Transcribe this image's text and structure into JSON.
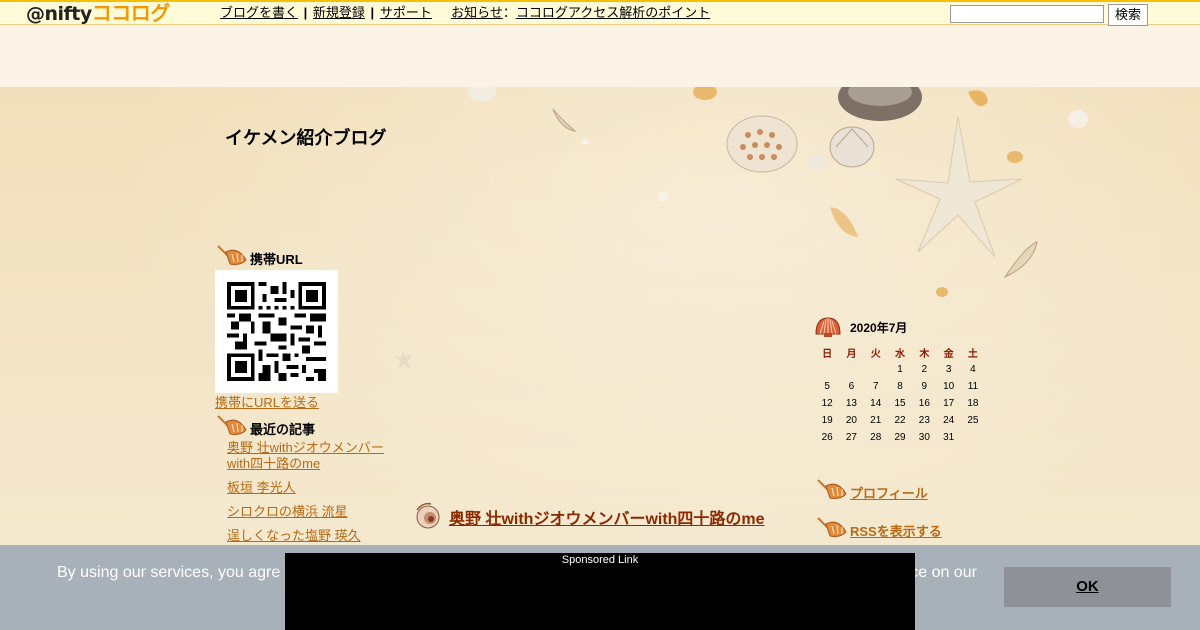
{
  "topbar": {
    "logo_at": "@nifty",
    "logo_brand": "ココログ",
    "nav": [
      {
        "label": "ブログを書く"
      },
      {
        "label": "新規登録"
      },
      {
        "label": "サポート"
      }
    ],
    "news_label": "お知らせ",
    "news_sep": "：",
    "news_link": "ココログアクセス解析のポイント",
    "separator": "|",
    "search_placeholder": "",
    "search_button": "検索"
  },
  "blog": {
    "title": "イケメン紹介ブログ"
  },
  "sidebar_left": {
    "mobile_heading": "携帯URL",
    "send_link": "携帯にURLを送る",
    "recent_heading": "最近の記事",
    "recent_items": [
      "奥野 壮withジオウメンバーwith四十路のme",
      "板垣 李光人",
      "シロクロの横浜 流星",
      "逞しくなった塩野 瑛久"
    ]
  },
  "main": {
    "post_title": "奥野 壮withジオウメンバーwith四十路のme"
  },
  "calendar": {
    "title": "2020年7月",
    "weekdays": [
      "日",
      "月",
      "火",
      "水",
      "木",
      "金",
      "土"
    ],
    "weeks": [
      [
        "",
        "",
        "",
        "1",
        "2",
        "3",
        "4"
      ],
      [
        "5",
        "6",
        "7",
        "8",
        "9",
        "10",
        "11"
      ],
      [
        "12",
        "13",
        "14",
        "15",
        "16",
        "17",
        "18"
      ],
      [
        "19",
        "20",
        "21",
        "22",
        "23",
        "24",
        "25"
      ],
      [
        "26",
        "27",
        "28",
        "29",
        "30",
        "31",
        ""
      ]
    ]
  },
  "sidebar_right": {
    "profile_link": "プロフィール",
    "rss_link": "RSSを表示する"
  },
  "cookie": {
    "text_left": "By using our services, you agre",
    "text_right": "ce on our",
    "ok_button": "OK"
  },
  "ad": {
    "label": "Sponsored Link"
  },
  "colors": {
    "link": "#b76b16",
    "post_title": "#8b2a00",
    "topbar_border": "#f2c200",
    "cookie_bg": "#a8b0ba"
  }
}
